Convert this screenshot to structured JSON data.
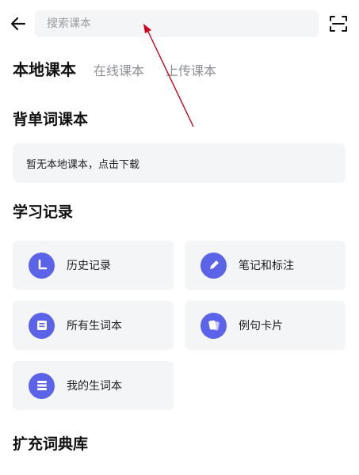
{
  "search": {
    "placeholder": "搜索课本"
  },
  "tabs": [
    {
      "label": "本地课本",
      "active": true
    },
    {
      "label": "在线课本",
      "active": false
    },
    {
      "label": "上传课本",
      "active": false
    }
  ],
  "sections": {
    "vocab_books": {
      "title": "背单词课本",
      "empty_notice": "暂无本地课本，点击下载"
    },
    "study_records": {
      "title": "学习记录",
      "items": [
        {
          "label": "历史记录",
          "icon": "clock-icon"
        },
        {
          "label": "笔记和标注",
          "icon": "pencil-icon"
        },
        {
          "label": "所有生词本",
          "icon": "notebook-icon"
        },
        {
          "label": "例句卡片",
          "icon": "cards-icon"
        },
        {
          "label": "我的生词本",
          "icon": "list-icon"
        }
      ]
    },
    "dictionaries": {
      "title": "扩充词典库"
    }
  },
  "colors": {
    "accent": "#5b63e8",
    "card_bg": "#f4f5f7",
    "annotation_arrow": "#d0021b"
  }
}
